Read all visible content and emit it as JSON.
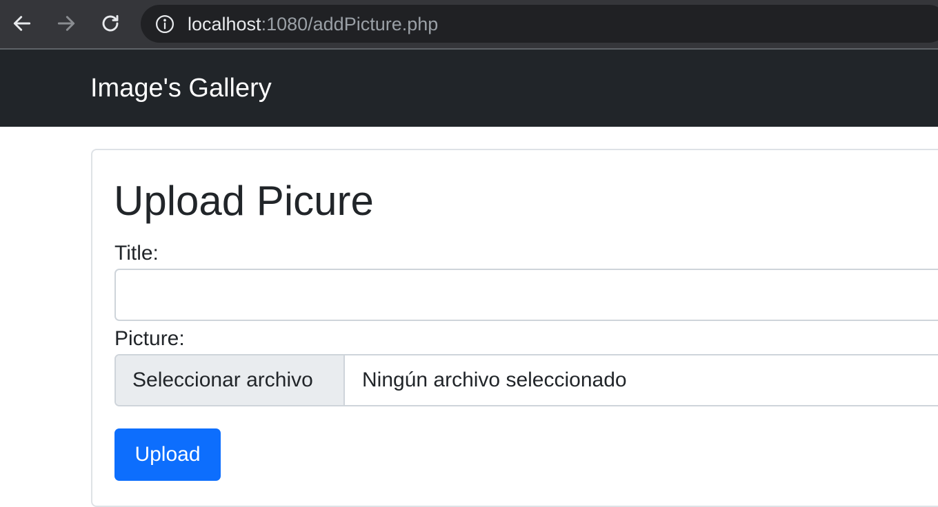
{
  "browser": {
    "url_host": "localhost",
    "url_rest": ":1080/addPicture.php",
    "back_icon": "arrow-left-icon",
    "forward_icon": "arrow-right-icon",
    "reload_icon": "reload-icon",
    "info_icon": "info-circle-icon"
  },
  "navbar": {
    "brand": "Image's Gallery"
  },
  "form": {
    "title": "Upload Picure",
    "title_label": "Title:",
    "title_value": "",
    "picture_label": "Picture:",
    "file_button_label": "Seleccionar archivo",
    "file_status": "Ningún archivo seleccionado",
    "submit_label": "Upload"
  },
  "colors": {
    "navbar_bg": "#212529",
    "primary": "#0d6efd",
    "browser_bg": "#35363a"
  }
}
